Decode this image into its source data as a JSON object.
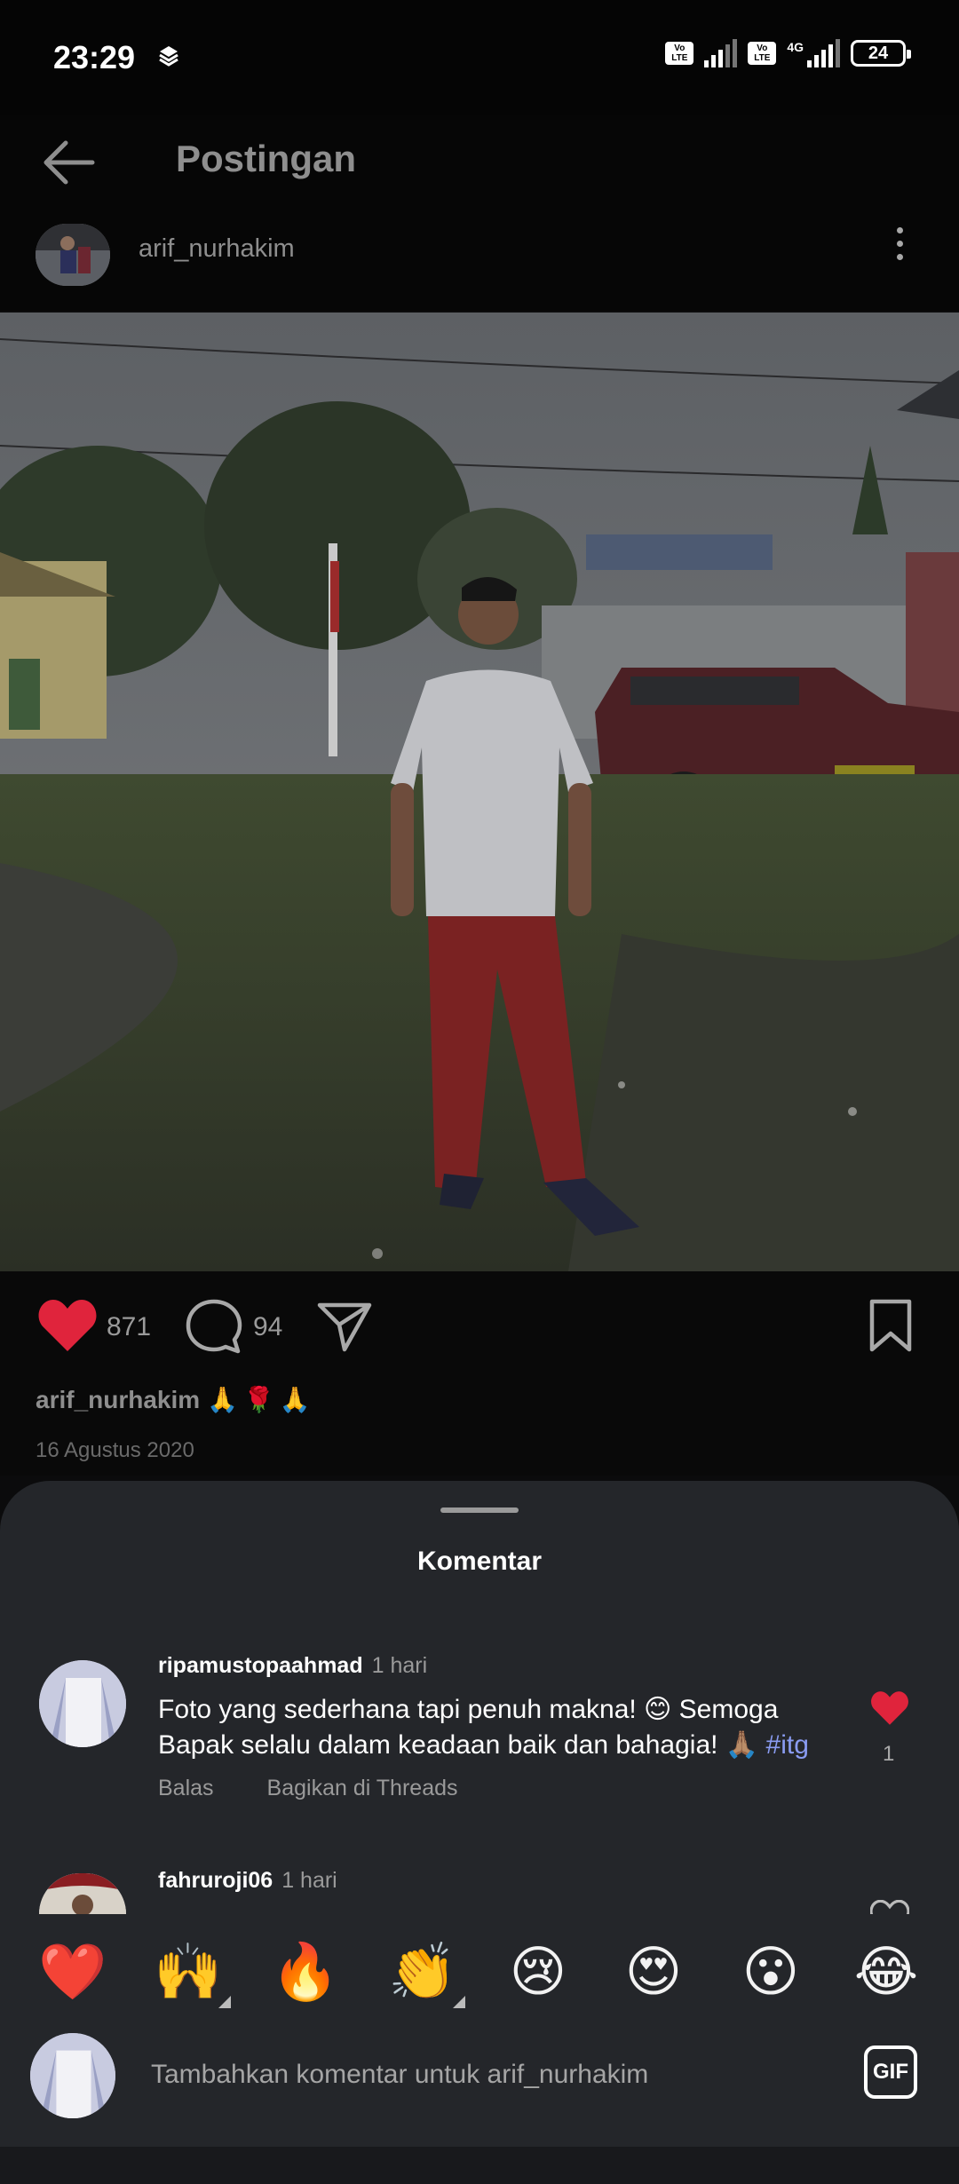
{
  "status_bar": {
    "time": "23:29",
    "battery": "24",
    "network": "4G",
    "volte_label": "Vo LTE",
    "icons": [
      "layers-icon",
      "volte-icon",
      "signal-icon",
      "battery-icon"
    ]
  },
  "header": {
    "title": "Postingan",
    "back_icon": "arrow-left-icon",
    "username": "arif_nurhakim",
    "more_icon": "more-vertical-icon"
  },
  "post": {
    "like_count": "871",
    "comment_count": "94",
    "caption_user": "arif_nurhakim",
    "caption_emojis": "🙏🌹🙏",
    "date": "16 Agustus 2020",
    "icons": [
      "heart-filled-icon",
      "comment-icon",
      "share-icon",
      "bookmark-icon"
    ],
    "colors": {
      "like": "#e0243c"
    }
  },
  "comments_sheet": {
    "title": "Komentar",
    "comments": [
      {
        "user": "ripamustopaahmad",
        "time": "1 hari",
        "text": "Foto yang sederhana tapi penuh makna! 😊 Semoga Bapak selalu dalam keadaan baik dan bahagia! 🙏🏽",
        "hashtag": "#itg",
        "reply_label": "Balas",
        "share_label": "Bagikan di Threads",
        "like_count": "1"
      },
      {
        "user": "fahruroji06",
        "time": "1 hari"
      }
    ]
  },
  "emoji_bar": {
    "emojis": [
      "❤️",
      "🙌",
      "🔥",
      "👏",
      "😢",
      "😍",
      "😮",
      "😂"
    ]
  },
  "comment_input": {
    "placeholder": "Tambahkan komentar untuk arif_nurhakim",
    "gif_label": "GIF"
  }
}
